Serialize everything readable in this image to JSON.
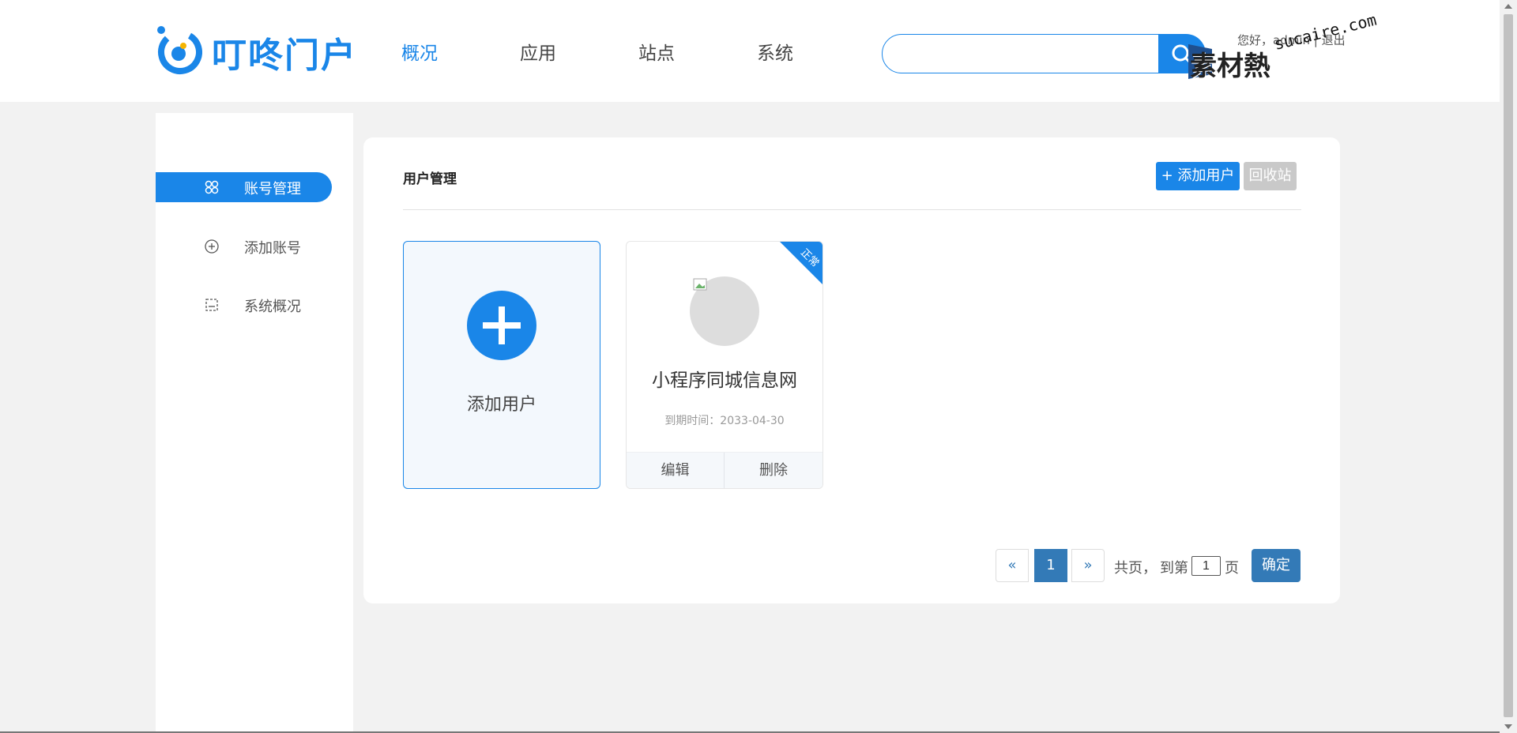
{
  "brand": {
    "name": "叮咚门户",
    "color": "#1a86e8"
  },
  "nav": [
    {
      "label": "概况",
      "active": true
    },
    {
      "label": "应用",
      "active": false
    },
    {
      "label": "站点",
      "active": false
    },
    {
      "label": "系统",
      "active": false
    }
  ],
  "search": {
    "value": "",
    "placeholder": "",
    "icon": "search-icon"
  },
  "user": {
    "greeting": "您好，admin",
    "separator": " | ",
    "logout": "退出"
  },
  "watermark": {
    "text_cn": "素材熱",
    "text_en": "sucaire.com"
  },
  "sidebar": {
    "items": [
      {
        "label": "账号管理",
        "icon": "grid-icon",
        "active": true
      },
      {
        "label": "添加账号",
        "icon": "plus-circle-icon",
        "active": false
      },
      {
        "label": "系统概况",
        "icon": "frame-icon",
        "active": false
      }
    ]
  },
  "main": {
    "title": "用户管理",
    "add_user_button": "+ 添加用户",
    "recycle_button": "回收站",
    "add_card_label": "添加用户",
    "sites": [
      {
        "name": "小程序同城信息网",
        "status": "正常",
        "expiry": "到期时间：2033-04-30",
        "edit": "编辑",
        "delete": "删除"
      }
    ]
  },
  "pagination": {
    "prev": "«",
    "current": "1",
    "next": "»",
    "total_text": "共页，",
    "goto_prefix": "到第",
    "goto_value": "1",
    "goto_suffix": "页",
    "confirm": "确定"
  },
  "colors": {
    "accent": "#1a86e8",
    "pager": "#337ab7",
    "recycle": "#c9c9c9",
    "page_bg": "#f2f2f2"
  }
}
